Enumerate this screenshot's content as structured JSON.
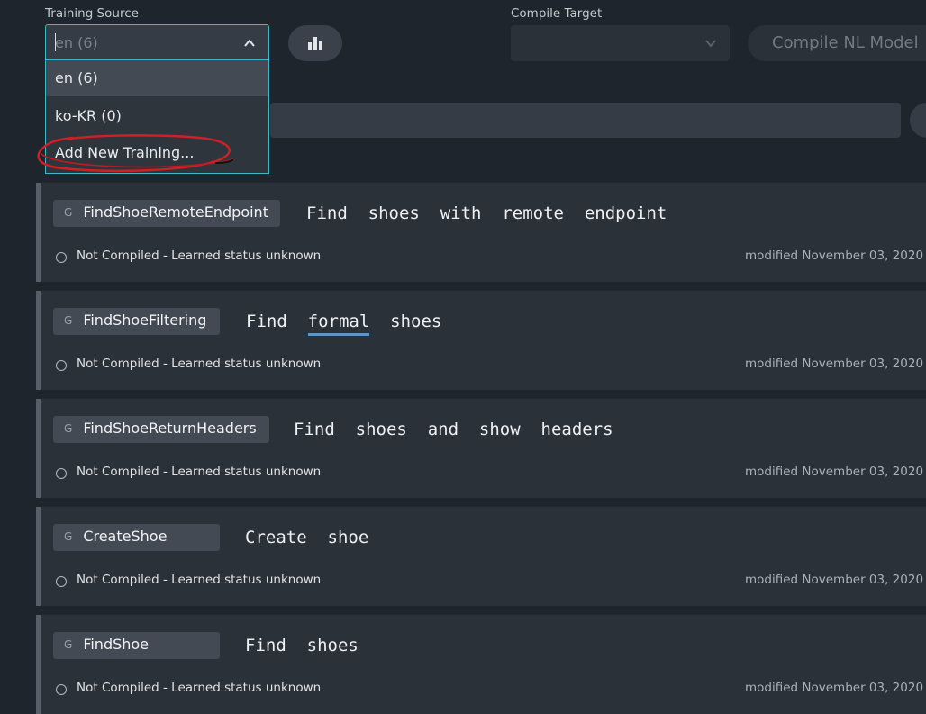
{
  "training_source": {
    "label": "Training Source",
    "value": "en (6)",
    "options": [
      "en (6)",
      "ko-KR (0)",
      "Add New Training..."
    ]
  },
  "compile_target": {
    "label": "Compile Target",
    "value": ""
  },
  "compile_button": {
    "label": "Compile NL Model"
  },
  "cards": [
    {
      "tag_letter": "G",
      "name": "FindShoeRemoteEndpoint",
      "utterance": "Find  shoes  with  remote  endpoint",
      "status": "Not Compiled - Learned status unknown",
      "modified": "modified November 03, 2020"
    },
    {
      "tag_letter": "G",
      "name": "FindShoeFiltering",
      "utterance_pre": "Find  ",
      "utterance_hl": "formal",
      "utterance_post": "  shoes",
      "status": "Not Compiled - Learned status unknown",
      "modified": "modified November 03, 2020"
    },
    {
      "tag_letter": "G",
      "name": "FindShoeReturnHeaders",
      "utterance": "Find  shoes  and  show  headers",
      "status": "Not Compiled - Learned status unknown",
      "modified": "modified November 03, 2020"
    },
    {
      "tag_letter": "G",
      "name": "CreateShoe",
      "utterance": "Create  shoe",
      "status": "Not Compiled - Learned status unknown",
      "modified": "modified November 03, 2020"
    },
    {
      "tag_letter": "G",
      "name": "FindShoe",
      "utterance": "Find  shoes",
      "status": "Not Compiled - Learned status unknown",
      "modified": "modified November 03, 2020"
    }
  ],
  "icons": {
    "chevron_up": "chevron-up-icon",
    "chevron_down": "chevron-down-icon",
    "stats": "bar-chart-icon",
    "status": "status-circle-icon"
  },
  "colors": {
    "background": "#1f252c",
    "card": "#2b3138",
    "focus_border": "#3fb8c6",
    "highlight_underline": "#5f95c6",
    "annotation": "#d21f26"
  }
}
